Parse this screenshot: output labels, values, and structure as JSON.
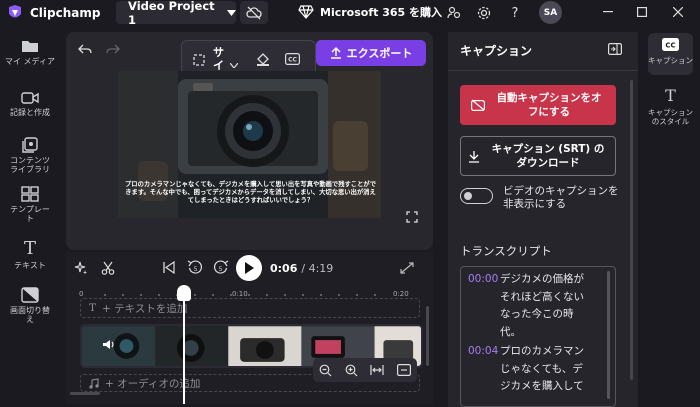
{
  "app": {
    "name": "Clipchamp",
    "project_title": "Video Project 1"
  },
  "topbar": {
    "ms365_label": "Microsoft 365 を購入",
    "avatar_initials": "SA"
  },
  "left_nav": [
    {
      "label": "マイ メディア",
      "icon": "folder-icon"
    },
    {
      "label": "記録と作成",
      "icon": "camera-icon"
    },
    {
      "label": "コンテンツ\nライブラリ",
      "icon": "library-icon"
    },
    {
      "label": "テンプレー\nト",
      "icon": "template-icon"
    },
    {
      "label": "テキスト",
      "icon": "text-icon"
    },
    {
      "label": "画面切り替\nえ",
      "icon": "transition-icon"
    }
  ],
  "preview": {
    "toolbar_size_label": "サイズ",
    "export_label": "エクスポート",
    "caption_text": "プロのカメラマンじゃなくても、デジカメを購入して思い出を写真や動画で残すことができます。そんな中でも、困ってデジカメからデータを消してしまい、大切な思い出が消えてしまったときはどうすればいいでしょう？"
  },
  "timeline": {
    "current_time": "0:06",
    "total_time": "/ 4:19",
    "ruler": [
      "0",
      "0:10",
      "0:20"
    ],
    "text_track_label": "+ テキストを追加",
    "audio_track_label": "+ オーディオの追加"
  },
  "caption_panel": {
    "title": "キャプション",
    "auto_off_button": "自動キャプションをオフにする",
    "download_button": "キャプション (SRT) のダウンロード",
    "hide_toggle_label": "ビデオのキャプションを非表示にする",
    "transcript_title": "トランスクリプト",
    "transcript": [
      {
        "time": "00:00",
        "lines": [
          "デジカメの価格が",
          "それほど高くない",
          "なった今この時",
          "代。"
        ]
      },
      {
        "time": "00:04",
        "lines": [
          "プロのカメラマン",
          "じゃなくても、デ",
          "ジカメを購入して"
        ]
      }
    ]
  },
  "right_rail": [
    {
      "label": "キャプション",
      "icon": "cc-icon"
    },
    {
      "label": "キャプションのスタイル",
      "icon": "text-style-icon"
    }
  ],
  "colors": {
    "accent": "#7a3fe4",
    "danger": "#c8344a",
    "time_accent": "#a57ef0"
  }
}
